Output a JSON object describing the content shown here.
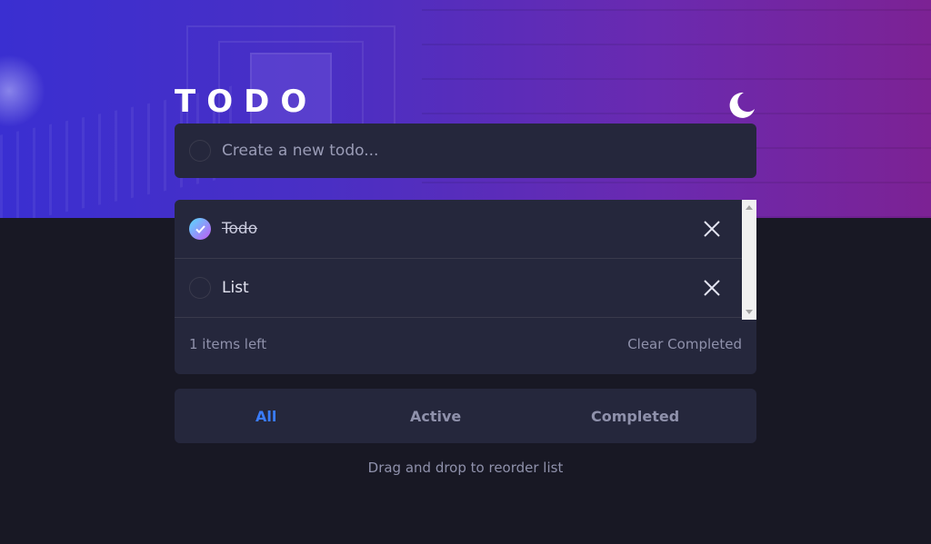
{
  "header": {
    "title": "TODO",
    "theme_icon": "moon-icon"
  },
  "create": {
    "placeholder": "Create a new todo...",
    "value": ""
  },
  "todos": [
    {
      "text": "Todo",
      "completed": true
    },
    {
      "text": "List",
      "completed": false
    }
  ],
  "footer": {
    "items_left": "1 items left",
    "clear_label": "Clear Completed"
  },
  "filters": {
    "all": "All",
    "active": "Active",
    "completed": "Completed",
    "selected": "All"
  },
  "hint": "Drag and drop to reorder list",
  "colors": {
    "accent": "#3a7cfd",
    "card": "#25273c",
    "background": "#181824",
    "check_gradient_start": "#57ddff",
    "check_gradient_end": "#c058f3"
  }
}
